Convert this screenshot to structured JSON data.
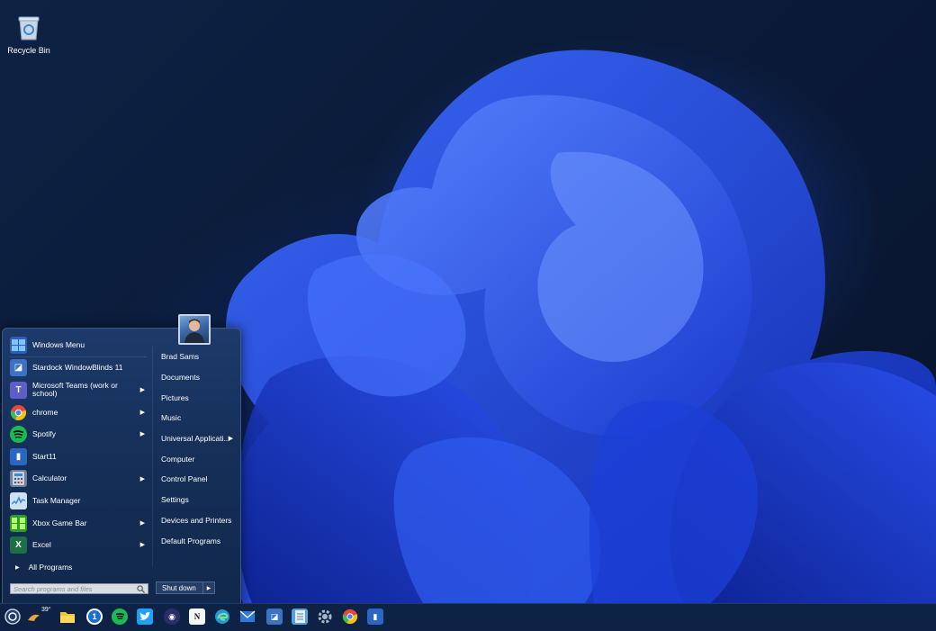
{
  "desktop": {
    "icons": [
      {
        "label": "Recycle Bin",
        "icon": "recycle-bin-icon"
      }
    ]
  },
  "start_menu": {
    "header": {
      "label": "Windows Menu",
      "icon": "windows-menu-icon"
    },
    "pinned": [
      {
        "label": "Stardock WindowBlinds 11",
        "icon": "windowblinds-icon",
        "submenu": false,
        "color": "#3a72c4"
      },
      {
        "label": "Microsoft Teams (work or school)",
        "icon": "teams-icon",
        "submenu": true,
        "color": "#5b5fc7"
      },
      {
        "label": "chrome",
        "icon": "chrome-icon",
        "submenu": true,
        "color": "#e8453c"
      },
      {
        "label": "Spotify",
        "icon": "spotify-icon",
        "submenu": true,
        "color": "#1db954"
      },
      {
        "label": "Start11",
        "icon": "start11-icon",
        "submenu": false,
        "color": "#2b66c2"
      },
      {
        "label": "Calculator",
        "icon": "calculator-icon",
        "submenu": true,
        "color": "#6d7f99"
      },
      {
        "label": "Task Manager",
        "icon": "task-manager-icon",
        "submenu": false,
        "color": "#3a8ad6"
      },
      {
        "label": "Xbox Game Bar",
        "icon": "xbox-game-bar-icon",
        "submenu": true,
        "color": "#2f9b2f"
      },
      {
        "label": "Excel",
        "icon": "excel-icon",
        "submenu": true,
        "color": "#1d7044"
      }
    ],
    "all_programs": "All Programs",
    "search_placeholder": "Search programs and files",
    "right_items": [
      {
        "label": "Brad Sams",
        "submenu": false
      },
      {
        "label": "Documents",
        "submenu": false
      },
      {
        "label": "Pictures",
        "submenu": false
      },
      {
        "label": "Music",
        "submenu": false
      },
      {
        "label": "Universal Applicati...",
        "submenu": true
      },
      {
        "label": "Computer",
        "submenu": false
      },
      {
        "label": "Control Panel",
        "submenu": false
      },
      {
        "label": "Settings",
        "submenu": false
      },
      {
        "label": "Devices and Printers",
        "submenu": false
      },
      {
        "label": "Default Programs",
        "submenu": false
      }
    ],
    "shutdown_label": "Shut down"
  },
  "taskbar": {
    "weather_temp": "39°",
    "icons": [
      {
        "name": "start-button-icon",
        "color": "#1e3c6e"
      },
      {
        "name": "weather-icon",
        "color": "#e8a33a"
      },
      {
        "name": "file-explorer-icon",
        "color": "#f2c230"
      },
      {
        "name": "1password-icon",
        "color": "#1a6fd0"
      },
      {
        "name": "spotify-icon",
        "color": "#1db954"
      },
      {
        "name": "twitter-icon",
        "color": "#1da1f2"
      },
      {
        "name": "app-circle-icon",
        "color": "#2a2f6a"
      },
      {
        "name": "notion-icon",
        "color": "#f5f5f5"
      },
      {
        "name": "edge-icon",
        "color": "#1f9ad6"
      },
      {
        "name": "mail-icon",
        "color": "#2b7bd6"
      },
      {
        "name": "windowblinds-icon",
        "color": "#3a72c4"
      },
      {
        "name": "notepad-icon",
        "color": "#5aa0e0"
      },
      {
        "name": "settings-icon",
        "color": "#7a8899"
      },
      {
        "name": "chrome-icon",
        "color": "#e8453c"
      },
      {
        "name": "start11-icon",
        "color": "#2b66c2"
      }
    ]
  }
}
